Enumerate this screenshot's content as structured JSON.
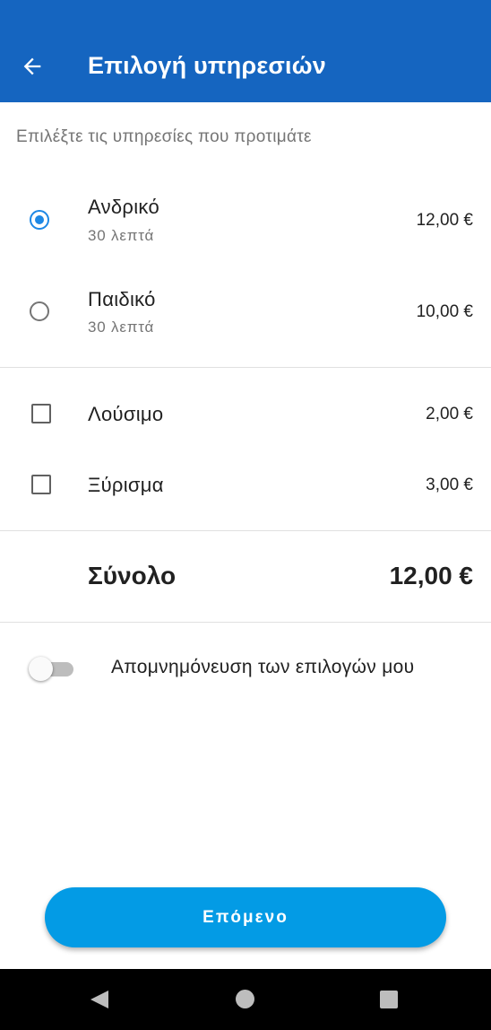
{
  "appbar": {
    "title": "Επιλογή υπηρεσιών",
    "back_icon": "arrow-left-icon"
  },
  "subtitle": "Επιλέξτε τις υπηρεσίες που προτιμάτε",
  "haircut_options": [
    {
      "label": "Ανδρικό",
      "duration": "30 λεπτά",
      "price": "12,00 €",
      "selected": true
    },
    {
      "label": "Παιδικό",
      "duration": "30 λεπτά",
      "price": "10,00 €",
      "selected": false
    }
  ],
  "extras": [
    {
      "label": "Λούσιμο",
      "price": "2,00 €",
      "checked": false
    },
    {
      "label": "Ξύρισμα",
      "price": "3,00 €",
      "checked": false
    }
  ],
  "total": {
    "label": "Σύνολο",
    "value": "12,00 €"
  },
  "remember_toggle": {
    "label": "Απομνημόνευση των επιλογών μου",
    "on": false
  },
  "next_button": {
    "label": "Επόμενο"
  },
  "colors": {
    "appbar": "#1565C0",
    "accent": "#1E88E5",
    "button": "#039BE5"
  }
}
